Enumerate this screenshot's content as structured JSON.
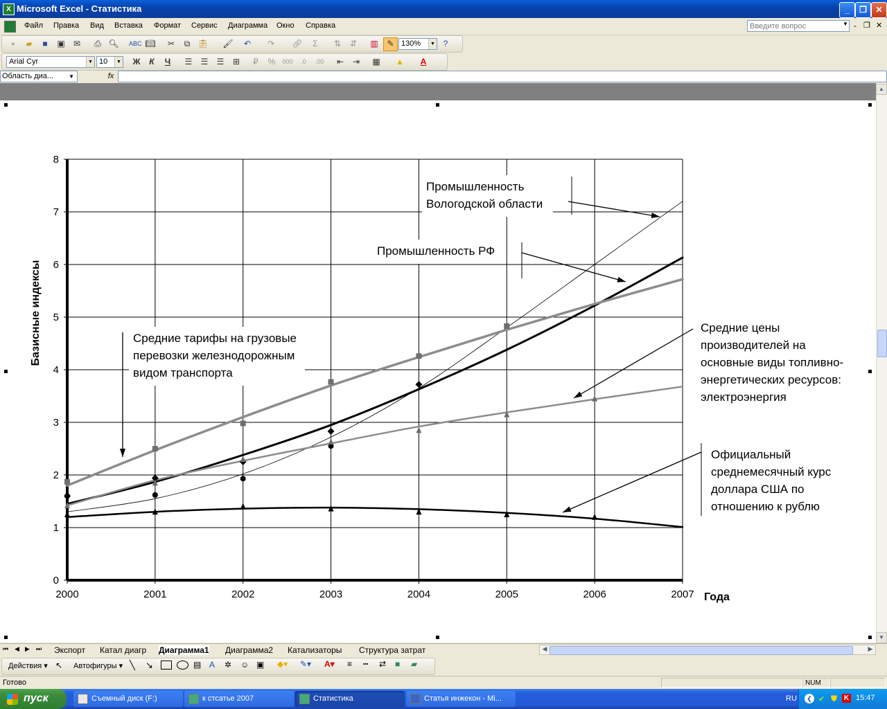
{
  "window": {
    "title": "Microsoft Excel - Статистика",
    "app_icon": "excel-icon",
    "buttons": [
      "minimize",
      "restore",
      "close"
    ]
  },
  "menu": {
    "items": [
      "Файл",
      "Правка",
      "Вид",
      "Вставка",
      "Формат",
      "Сервис",
      "Диаграмма",
      "Окно",
      "Справка"
    ],
    "ask_placeholder": "Введите вопрос"
  },
  "toolbar": {
    "zoom": "130%",
    "font_name": "Arial Cyr",
    "font_size": "10",
    "bold_label": "Ж",
    "italic_label": "К",
    "underline_label": "Ч"
  },
  "formula_bar": {
    "name_box": "Область диа...",
    "fx_label": "fx",
    "value": ""
  },
  "chart_data": {
    "type": "line",
    "title": "",
    "ylabel": "Базисные индексы",
    "xlabel": "Года",
    "x": [
      2000,
      2001,
      2002,
      2003,
      2004,
      2005,
      2006,
      2007
    ],
    "xlim": [
      2000,
      2007
    ],
    "ylim": [
      0,
      8
    ],
    "yticks": [
      0,
      1,
      2,
      3,
      4,
      5,
      6,
      7,
      8
    ],
    "grid": true,
    "series": [
      {
        "name": "Промышленность Вологодской области",
        "marker": "circle",
        "points": [
          [
            2000,
            1.6
          ],
          [
            2001,
            1.62
          ],
          [
            2002,
            1.93
          ],
          [
            2003,
            2.55
          ]
        ],
        "trend": [
          [
            2000,
            1.3
          ],
          [
            2001,
            1.55
          ],
          [
            2002,
            2.02
          ],
          [
            2003,
            2.72
          ],
          [
            2004,
            3.65
          ],
          [
            2005,
            4.8
          ],
          [
            2006,
            6.0
          ],
          [
            2007,
            7.2
          ]
        ],
        "color": "#000000",
        "width": 0.8
      },
      {
        "name": "Промышленность РФ",
        "marker": "diamond",
        "points": [
          [
            2000,
            1.6
          ],
          [
            2001,
            1.94
          ],
          [
            2002,
            2.25
          ],
          [
            2003,
            2.83
          ],
          [
            2004,
            3.72
          ]
        ],
        "trend": [
          [
            2000,
            1.45
          ],
          [
            2001,
            1.87
          ],
          [
            2002,
            2.38
          ],
          [
            2003,
            2.95
          ],
          [
            2004,
            3.63
          ],
          [
            2005,
            4.38
          ],
          [
            2006,
            5.22
          ],
          [
            2007,
            6.13
          ]
        ],
        "color": "#000000",
        "width": 3
      },
      {
        "name": "Средние тарифы на грузовые перевозки железнодорожным видом транспорта",
        "marker": "square",
        "points": [
          [
            2000,
            1.87
          ],
          [
            2001,
            2.5
          ],
          [
            2002,
            2.98
          ],
          [
            2003,
            3.77
          ],
          [
            2004,
            4.26
          ],
          [
            2005,
            4.83
          ]
        ],
        "trend": [
          [
            2000,
            1.8
          ],
          [
            2001,
            2.47
          ],
          [
            2002,
            3.1
          ],
          [
            2003,
            3.7
          ],
          [
            2004,
            4.24
          ],
          [
            2005,
            4.76
          ],
          [
            2006,
            5.25
          ],
          [
            2007,
            5.72
          ]
        ],
        "color": "#8C8C8C",
        "width": 3.5
      },
      {
        "name": "Средние цены производителей на основные виды топливно-энергетических ресурсов: электроэнергия",
        "marker": "triangle",
        "points": [
          [
            2000,
            1.42
          ],
          [
            2001,
            1.85
          ],
          [
            2002,
            2.3
          ],
          [
            2003,
            2.63
          ],
          [
            2004,
            2.85
          ],
          [
            2005,
            3.15
          ],
          [
            2006,
            3.45
          ]
        ],
        "trend": [
          [
            2000,
            1.42
          ],
          [
            2001,
            1.9
          ],
          [
            2002,
            2.27
          ],
          [
            2003,
            2.6
          ],
          [
            2004,
            2.92
          ],
          [
            2005,
            3.19
          ],
          [
            2006,
            3.44
          ],
          [
            2007,
            3.68
          ]
        ],
        "color": "#8C8C8C",
        "width": 2.5
      },
      {
        "name": "Официальный среднемесячный курс доллара США по отношению к рублю",
        "marker": "triangle",
        "points": [
          [
            2000,
            1.25
          ],
          [
            2001,
            1.3
          ],
          [
            2002,
            1.4
          ],
          [
            2003,
            1.36
          ],
          [
            2004,
            1.3
          ],
          [
            2005,
            1.25
          ],
          [
            2006,
            1.2
          ]
        ],
        "trend": [
          [
            2000,
            1.2
          ],
          [
            2001,
            1.3
          ],
          [
            2002,
            1.36
          ],
          [
            2003,
            1.38
          ],
          [
            2004,
            1.35
          ],
          [
            2005,
            1.28
          ],
          [
            2006,
            1.17
          ],
          [
            2007,
            1.01
          ]
        ],
        "color": "#000000",
        "width": 2.5
      }
    ],
    "annotations": [
      {
        "lines": [
          "Промышленность",
          "Вологодской области"
        ]
      },
      {
        "lines": [
          "Промышленность РФ"
        ]
      },
      {
        "lines": [
          "Средние тарифы на грузовые",
          "перевозки железнодорожным",
          "видом транспорта"
        ]
      },
      {
        "lines": [
          "Средние цены",
          "производителей на",
          "основные виды топливно-",
          "энергетических ресурсов:",
          "электроэнергия"
        ]
      },
      {
        "lines": [
          "Официальный",
          "среднемесячный курс",
          "доллара США по",
          "отношению к рублю"
        ]
      }
    ]
  },
  "sheet_tabs": {
    "items": [
      "Экспорт",
      "Катал диагр",
      "Диаграмма1",
      "Диаграмма2",
      "Катализаторы",
      "Структура затрат"
    ],
    "active": "Диаграмма1"
  },
  "drawing_toolbar": {
    "actions_label": "Действия",
    "autoshapes_label": "Автофигуры"
  },
  "status": {
    "text": "Готово",
    "num": "NUM"
  },
  "taskbar": {
    "start_label": "пуск",
    "tasks": [
      "Съемный диск (F:)",
      "к стсатье 2007",
      "Статистика",
      "Статья инжекон - Mi..."
    ],
    "active_task": "Статистика",
    "lang": "RU",
    "clock": "15:47"
  }
}
